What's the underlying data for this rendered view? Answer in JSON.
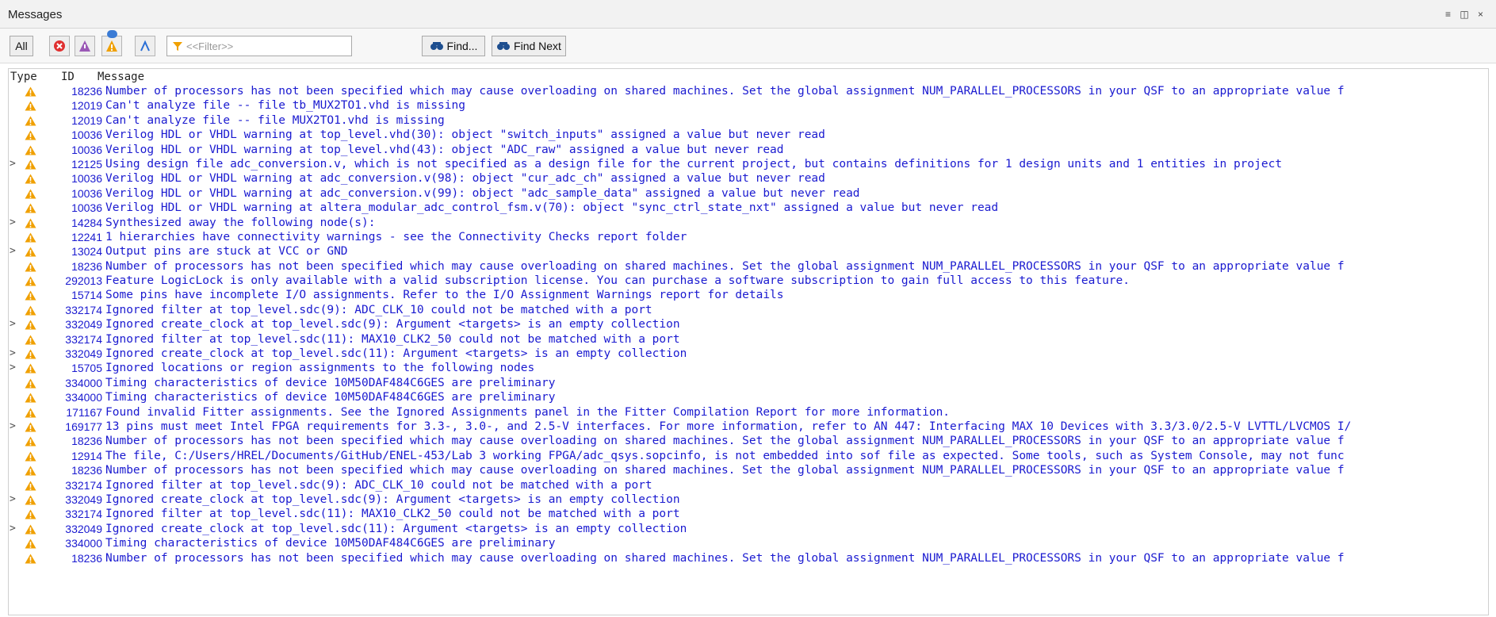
{
  "window": {
    "title": "Messages",
    "controls": "≡ ◫ ×"
  },
  "toolbar": {
    "all_label": "All",
    "filter_placeholder": "<<Filter>>",
    "find_label": "Find...",
    "find_next_label": "Find Next"
  },
  "columns": {
    "type": "Type",
    "id": "ID",
    "message": "Message"
  },
  "colors": {
    "message_text": "#1a1ad0",
    "warning_icon": "#f0a000"
  },
  "rows": [
    {
      "exp": "",
      "id": "18236",
      "msg": "Number of processors has not been specified which may cause overloading on shared machines.  Set the global assignment NUM_PARALLEL_PROCESSORS in your QSF to an appropriate value f"
    },
    {
      "exp": "",
      "id": "12019",
      "msg": "Can't analyze file -- file tb_MUX2TO1.vhd is missing"
    },
    {
      "exp": "",
      "id": "12019",
      "msg": "Can't analyze file -- file MUX2TO1.vhd is missing"
    },
    {
      "exp": "",
      "id": "10036",
      "msg": "Verilog HDL or VHDL warning at top_level.vhd(30): object \"switch_inputs\" assigned a value but never read"
    },
    {
      "exp": "",
      "id": "10036",
      "msg": "Verilog HDL or VHDL warning at top_level.vhd(43): object \"ADC_raw\" assigned a value but never read"
    },
    {
      "exp": ">",
      "id": "12125",
      "msg": "Using design file adc_conversion.v, which is not specified as a design file for the current project, but contains definitions for 1 design units and 1 entities in project"
    },
    {
      "exp": "",
      "id": "10036",
      "msg": "Verilog HDL or VHDL warning at adc_conversion.v(98): object \"cur_adc_ch\" assigned a value but never read"
    },
    {
      "exp": "",
      "id": "10036",
      "msg": "Verilog HDL or VHDL warning at adc_conversion.v(99): object \"adc_sample_data\" assigned a value but never read"
    },
    {
      "exp": "",
      "id": "10036",
      "msg": "Verilog HDL or VHDL warning at altera_modular_adc_control_fsm.v(70): object \"sync_ctrl_state_nxt\" assigned a value but never read"
    },
    {
      "exp": ">",
      "id": "14284",
      "msg": "Synthesized away the following node(s):"
    },
    {
      "exp": "",
      "id": "12241",
      "msg": "1 hierarchies have connectivity warnings - see the Connectivity Checks report folder"
    },
    {
      "exp": ">",
      "id": "13024",
      "msg": "Output pins are stuck at VCC or GND"
    },
    {
      "exp": "",
      "id": "18236",
      "msg": "Number of processors has not been specified which may cause overloading on shared machines.  Set the global assignment NUM_PARALLEL_PROCESSORS in your QSF to an appropriate value f"
    },
    {
      "exp": "",
      "id": "292013",
      "msg": "Feature LogicLock is only available with a valid subscription license. You can purchase a software subscription to gain full access to this feature."
    },
    {
      "exp": "",
      "id": "15714",
      "msg": "Some pins have incomplete I/O assignments. Refer to the I/O Assignment Warnings report for details"
    },
    {
      "exp": "",
      "id": "332174",
      "msg": "Ignored filter at top_level.sdc(9): ADC_CLK_10 could not be matched with a port"
    },
    {
      "exp": ">",
      "id": "332049",
      "msg": "Ignored create_clock at top_level.sdc(9): Argument <targets> is an empty collection"
    },
    {
      "exp": "",
      "id": "332174",
      "msg": "Ignored filter at top_level.sdc(11): MAX10_CLK2_50 could not be matched with a port"
    },
    {
      "exp": ">",
      "id": "332049",
      "msg": "Ignored create_clock at top_level.sdc(11): Argument <targets> is an empty collection"
    },
    {
      "exp": ">",
      "id": "15705",
      "msg": "Ignored locations or region assignments to the following nodes"
    },
    {
      "exp": "",
      "id": "334000",
      "msg": "Timing characteristics of device 10M50DAF484C6GES are preliminary"
    },
    {
      "exp": "",
      "id": "334000",
      "msg": "Timing characteristics of device 10M50DAF484C6GES are preliminary"
    },
    {
      "exp": "",
      "id": "171167",
      "msg": "Found invalid Fitter assignments. See the Ignored Assignments panel in the Fitter Compilation Report for more information."
    },
    {
      "exp": ">",
      "id": "169177",
      "msg": "13 pins must meet Intel FPGA requirements for 3.3-, 3.0-, and 2.5-V interfaces. For more information, refer to AN 447: Interfacing MAX 10 Devices with 3.3/3.0/2.5-V LVTTL/LVCMOS I/"
    },
    {
      "exp": "",
      "id": "18236",
      "msg": "Number of processors has not been specified which may cause overloading on shared machines.  Set the global assignment NUM_PARALLEL_PROCESSORS in your QSF to an appropriate value f"
    },
    {
      "exp": "",
      "id": "12914",
      "msg": "The file, C:/Users/HREL/Documents/GitHub/ENEL-453/Lab 3 working FPGA/adc_qsys.sopcinfo, is not embedded into sof file as expected.  Some tools, such as System Console, may not func"
    },
    {
      "exp": "",
      "id": "18236",
      "msg": "Number of processors has not been specified which may cause overloading on shared machines.  Set the global assignment NUM_PARALLEL_PROCESSORS in your QSF to an appropriate value f"
    },
    {
      "exp": "",
      "id": "332174",
      "msg": "Ignored filter at top_level.sdc(9): ADC_CLK_10 could not be matched with a port"
    },
    {
      "exp": ">",
      "id": "332049",
      "msg": "Ignored create_clock at top_level.sdc(9): Argument <targets> is an empty collection"
    },
    {
      "exp": "",
      "id": "332174",
      "msg": "Ignored filter at top_level.sdc(11): MAX10_CLK2_50 could not be matched with a port"
    },
    {
      "exp": ">",
      "id": "332049",
      "msg": "Ignored create_clock at top_level.sdc(11): Argument <targets> is an empty collection"
    },
    {
      "exp": "",
      "id": "334000",
      "msg": "Timing characteristics of device 10M50DAF484C6GES are preliminary"
    },
    {
      "exp": "",
      "id": "18236",
      "msg": "Number of processors has not been specified which may cause overloading on shared machines.  Set the global assignment NUM_PARALLEL_PROCESSORS in your QSF to an appropriate value f"
    }
  ]
}
